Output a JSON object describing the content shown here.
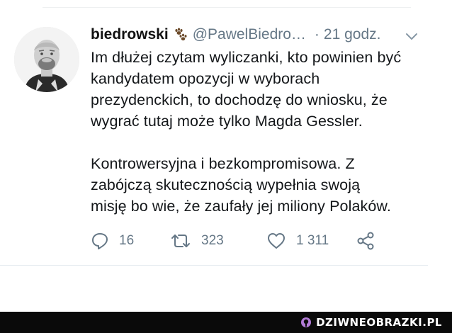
{
  "tweet": {
    "display_name": "biedrowski",
    "handle": "@PawelBiedro…",
    "separator": "·",
    "time": "21 godz.",
    "body_lines_1": [
      "Im dłużej czytam wyliczanki, kto powinien być",
      "kandydatem opozycji w wyborach",
      "prezydenckich, to dochodzę do wniosku, że",
      "wygrać tutaj może tylko Magda Gessler."
    ],
    "body_lines_2": [
      "Kontrowersyjna i bezkompromisowa. Z",
      "zabójczą skutecznością wypełnia swoją",
      "misję bo wie, że zaufały jej miliony Polaków."
    ],
    "replies": "16",
    "retweets": "323",
    "likes": "1 311"
  },
  "icons": {
    "avatar": "avatar",
    "name_emoji": "paw-prints-icon",
    "menu": "chevron-down-icon",
    "reply": "reply-icon",
    "retweet": "retweet-icon",
    "like": "heart-icon",
    "share": "share-icon",
    "brand": "brand-logo-icon"
  },
  "watermark": {
    "text": "DZIWNEOBRAZKI.PL"
  },
  "colors": {
    "text": "#14171a",
    "muted": "#657786",
    "footer_bg": "#0a0a0a",
    "brand_accent": "#b27bd6"
  }
}
